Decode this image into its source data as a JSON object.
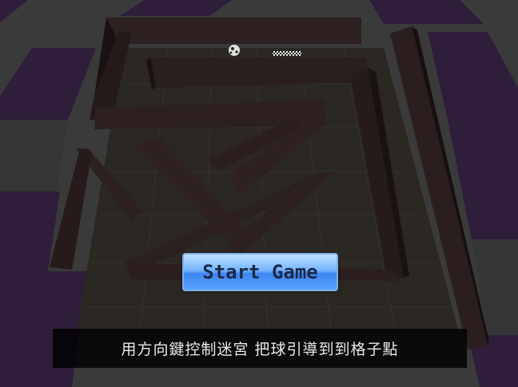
{
  "start_button": {
    "label": "Start Game"
  },
  "hint": {
    "text": "用方向鍵控制迷宮  把球引導到到格子點"
  },
  "colors": {
    "checker_purple": "#2f1e3a",
    "checker_gray": "#3a3a3a",
    "floor": "#2b2823",
    "wall_top": "#2c2020",
    "wall_side": "#1a1212",
    "button_blue": "#5aa2ff",
    "hint_bg": "#000000"
  },
  "icons": {
    "ball": "soccer-ball-icon",
    "goal": "checkered-goal-icon"
  }
}
